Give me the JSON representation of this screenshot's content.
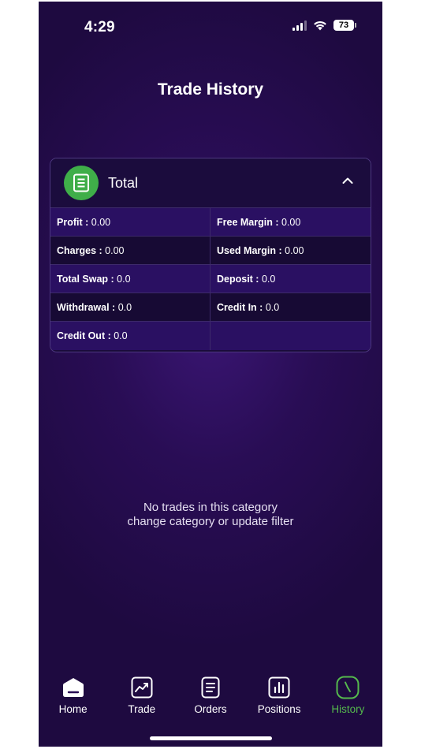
{
  "status": {
    "time": "4:29",
    "battery": "73"
  },
  "header": {
    "title": "Trade History"
  },
  "total": {
    "title": "Total",
    "rows": [
      [
        {
          "label": "Profit :",
          "value": "0.00"
        },
        {
          "label": "Free Margin :",
          "value": "0.00"
        }
      ],
      [
        {
          "label": "Charges :",
          "value": "0.00"
        },
        {
          "label": "Used Margin :",
          "value": "0.00"
        }
      ],
      [
        {
          "label": "Total Swap :",
          "value": "0.0"
        },
        {
          "label": "Deposit :",
          "value": "0.0"
        }
      ],
      [
        {
          "label": "Withdrawal :",
          "value": "0.0"
        },
        {
          "label": "Credit In :",
          "value": "0.0"
        }
      ],
      [
        {
          "label": "Credit Out :",
          "value": "0.0"
        }
      ]
    ]
  },
  "empty_state": {
    "line1": "No trades in this category",
    "line2": "change category or update filter"
  },
  "nav": {
    "items": [
      {
        "label": "Home",
        "icon": "home-icon"
      },
      {
        "label": "Trade",
        "icon": "trade-chart-icon"
      },
      {
        "label": "Orders",
        "icon": "orders-icon"
      },
      {
        "label": "Positions",
        "icon": "positions-icon"
      },
      {
        "label": "History",
        "icon": "history-clock-icon"
      }
    ],
    "active": "History"
  },
  "colors": {
    "background": "#290d55",
    "accent_green": "#55b94d",
    "doc_circle": "#3fae49"
  }
}
